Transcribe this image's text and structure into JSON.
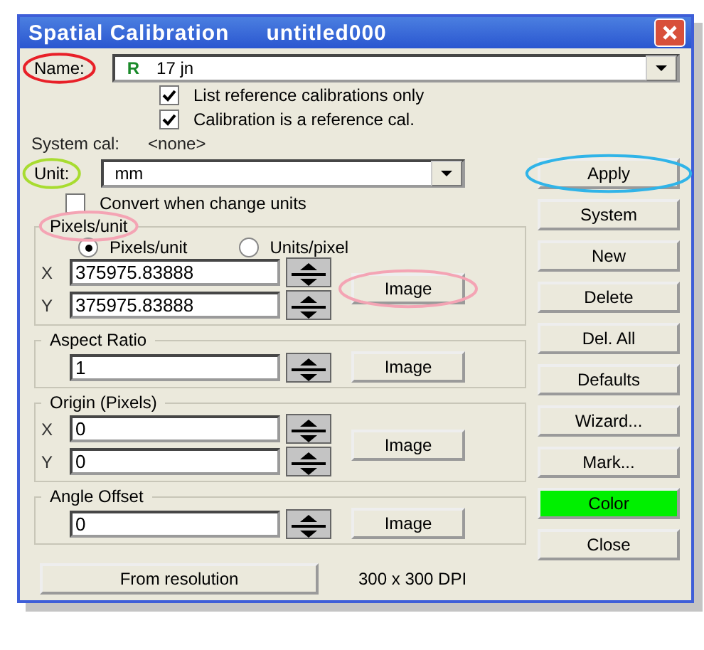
{
  "window": {
    "title": "Spatial Calibration",
    "document": "untitled000"
  },
  "name": {
    "label": "Name:",
    "circle": {
      "color": "#e82028"
    },
    "badge": "R",
    "value": "17 jn"
  },
  "options": [
    {
      "label": "List reference calibrations only",
      "checked": true
    },
    {
      "label": "Calibration is a reference cal.",
      "checked": true
    }
  ],
  "system_cal": {
    "label": "System cal:",
    "value": "<none>"
  },
  "unit": {
    "label": "Unit:",
    "circle": {
      "color": "#a8dc30"
    },
    "value": "mm",
    "apply": {
      "label": "Apply",
      "circle": {
        "color": "#30b4e8"
      }
    }
  },
  "convert": {
    "label": "Convert when change units",
    "checked": false
  },
  "groups": [
    {
      "title": "Pixels/unit",
      "circle": {
        "color": "#f4a4b4"
      },
      "modes": [
        {
          "label": "Pixels/unit",
          "selected": true
        },
        {
          "label": "Units/pixel",
          "selected": false
        }
      ],
      "fields": [
        {
          "label": "X",
          "value": "375975.83888"
        },
        {
          "label": "Y",
          "value": "375975.83888"
        }
      ],
      "image_button": {
        "label": "Image",
        "circle": {
          "color": "#f4a4b4"
        }
      }
    },
    {
      "title": "Aspect Ratio",
      "fields": [
        {
          "value": "1"
        }
      ],
      "image_button": {
        "label": "Image"
      }
    },
    {
      "title": "Origin (Pixels)",
      "fields": [
        {
          "label": "X",
          "value": "0"
        },
        {
          "label": "Y",
          "value": "0"
        }
      ],
      "image_button": {
        "label": "Image"
      }
    },
    {
      "title": "Angle Offset",
      "fields": [
        {
          "value": "0"
        }
      ],
      "image_button": {
        "label": "Image"
      }
    }
  ],
  "buttons": [
    {
      "label": "System"
    },
    {
      "label": "New"
    },
    {
      "label": "Delete"
    },
    {
      "label": "Del. All"
    },
    {
      "label": "Defaults"
    },
    {
      "label": "Wizard..."
    },
    {
      "label": "Mark..."
    },
    {
      "label": "Color",
      "color": "#00f000"
    },
    {
      "label": "Close"
    }
  ],
  "footer": {
    "button": "From resolution",
    "resolution": "300 x 300 DPI"
  }
}
